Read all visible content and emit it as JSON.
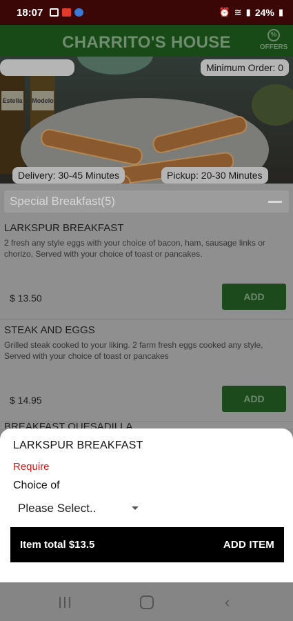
{
  "status_bar": {
    "time": "18:07",
    "battery": "24%",
    "notification_icons": [
      "gallery-icon",
      "gmail-icon",
      "messenger-icon"
    ],
    "system_icons": [
      "alarm-icon",
      "wifi-icon",
      "signal-icon",
      "battery-icon"
    ]
  },
  "app_bar": {
    "title": "CHARRITO'S HOUSE",
    "offers_label": "OFFERS"
  },
  "banner": {
    "min_order": "Minimum Order:  0",
    "delivery": "Delivery:  30-45 Minutes",
    "pickup": "Pickup:  20-30 Minutes",
    "bottle_labels": [
      "Estella",
      "Modelo"
    ]
  },
  "menu": {
    "category": "Special Breakfast(5)",
    "items": [
      {
        "name": "LARKSPUR BREAKFAST",
        "description": "2 fresh any style eggs with your choice of bacon, ham, sausage links or chorizo, Served with your choice of toast or pancakes.",
        "price": "$ 13.50",
        "add_label": "ADD"
      },
      {
        "name": "STEAK AND EGGS",
        "description": "Grilled steak cooked to your liking. 2 farm fresh eggs cooked any style, Served with your choice of toast or pancakes",
        "price": "$ 14.95",
        "add_label": "ADD"
      }
    ],
    "partial_item": "BREAKFAST QUESADILLA"
  },
  "sheet": {
    "title": "LARKSPUR BREAKFAST",
    "require_label": "Require",
    "choice_label": "Choice of",
    "select_value": "Please Select..",
    "total_label": "Item total $13.5",
    "add_item_label": "ADD ITEM"
  },
  "colors": {
    "status_bar": "#3a0606",
    "app_bar": "#174a17",
    "add_button": "#1d4a1d",
    "require": "#d41515",
    "action_bar": "#000000"
  }
}
